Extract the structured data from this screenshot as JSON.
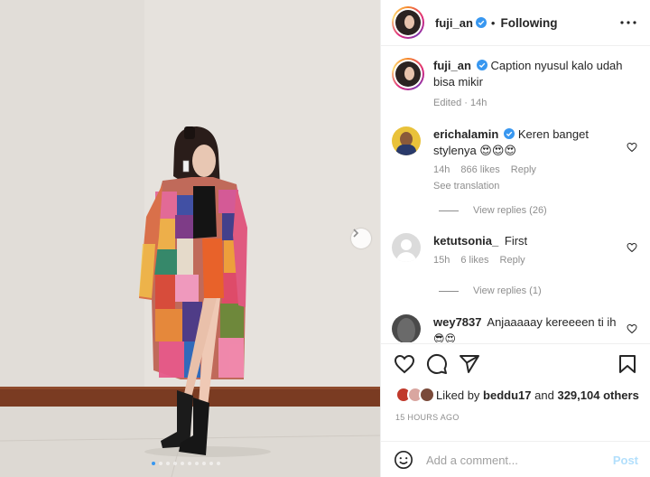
{
  "post": {
    "author": "fuji_an",
    "follow_status": "Following",
    "carousel_count": 10,
    "carousel_active": 0
  },
  "caption": {
    "username": "fuji_an",
    "text": "Caption nyusul kalo udah bisa mikir",
    "meta": "Edited · 14h"
  },
  "comments": [
    {
      "username": "erichalamin",
      "text": "Keren banget stylenya 😍😍😍",
      "time": "14h",
      "likes": "866 likes",
      "reply": "Reply",
      "translation": "See translation",
      "view_replies": "View replies (26)"
    },
    {
      "username": "ketutsonia_",
      "text": "First",
      "time": "15h",
      "likes": "6 likes",
      "reply": "Reply",
      "view_replies": "View replies (1)"
    },
    {
      "username": "wey7837",
      "text": "Anjaaaaay kereeeen ti ih",
      "extra": "😎😍"
    }
  ],
  "likes": {
    "prefix": "Liked by",
    "user": "beddu17",
    "middle": "and",
    "count": "329,104 others"
  },
  "timestamp": "15 HOURS AGO",
  "composer": {
    "placeholder": "Add a comment...",
    "post_label": "Post"
  },
  "colors": {
    "accent": "#0095f6",
    "verified": "#3897f0",
    "meta": "#8e8e8e"
  }
}
